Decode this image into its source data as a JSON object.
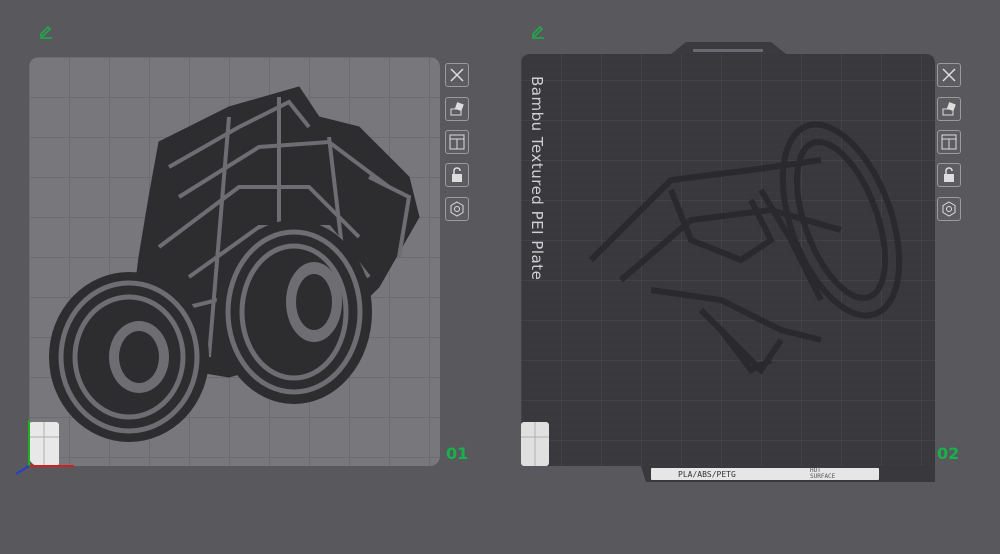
{
  "plates": [
    {
      "number": "01"
    },
    {
      "number": "02",
      "name": "Bambu Textured PEI Plate",
      "material_label": "PLA/ABS/PETG",
      "hot_label": "HOT",
      "surface_label": "SURFACE"
    }
  ],
  "toolbar_icons": [
    "close-icon",
    "auto-orient-icon",
    "arrange-icon",
    "lock-icon",
    "settings-icon"
  ],
  "colors": {
    "accent": "#18b24a",
    "background": "#58585d"
  }
}
